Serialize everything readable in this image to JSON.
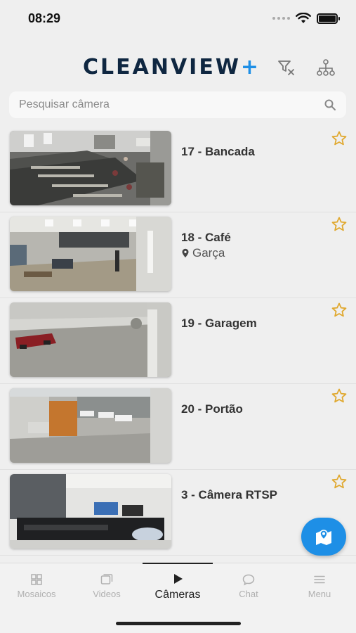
{
  "status": {
    "time": "08:29"
  },
  "header": {
    "logo_main": "CLEANVIEW",
    "logo_plus": "+"
  },
  "search": {
    "placeholder": "Pesquisar câmera",
    "value": ""
  },
  "cameras": [
    {
      "title": "17 - Bancada",
      "location": ""
    },
    {
      "title": "18 - Café",
      "location": "Garça"
    },
    {
      "title": "19 - Garagem",
      "location": ""
    },
    {
      "title": "20 - Portão",
      "location": ""
    },
    {
      "title": "3 - Câmera RTSP",
      "location": ""
    }
  ],
  "tabs": [
    {
      "label": "Mosaicos",
      "icon": "grid-icon",
      "active": false
    },
    {
      "label": "Videos",
      "icon": "videos-icon",
      "active": false
    },
    {
      "label": "Câmeras",
      "icon": "play-icon",
      "active": true
    },
    {
      "label": "Chat",
      "icon": "chat-icon",
      "active": false
    },
    {
      "label": "Menu",
      "icon": "menu-icon",
      "active": false
    }
  ],
  "colors": {
    "accent": "#1e8fe6",
    "star": "#e0a82e",
    "logo": "#0f2741"
  }
}
